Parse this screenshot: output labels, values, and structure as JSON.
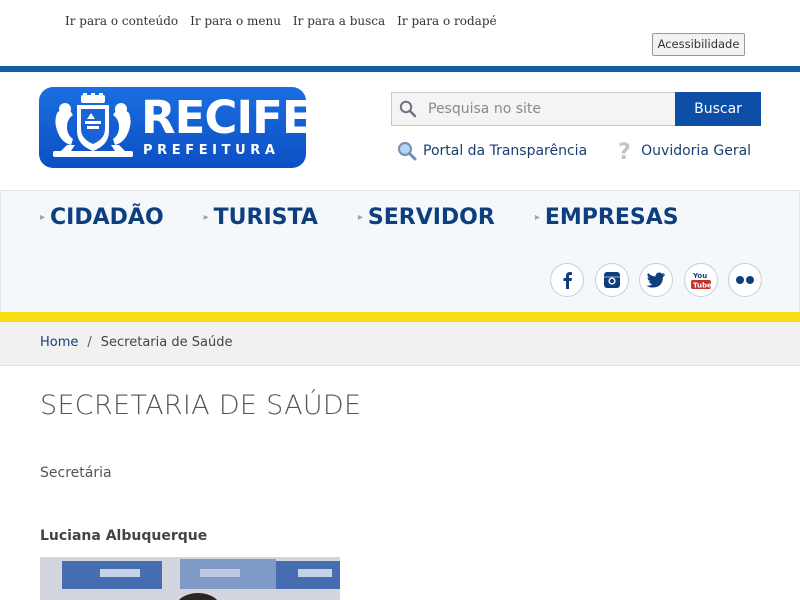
{
  "skip_links": [
    "Ir para o conteúdo",
    "Ir para o menu",
    "Ir para a busca",
    "Ir para o rodapé"
  ],
  "accessibility_label": "Acessibilidade",
  "logo": {
    "word": "RECIFE",
    "sub": "PREFEITURA"
  },
  "search": {
    "placeholder": "Pesquisa no site",
    "button": "Buscar"
  },
  "top_links": [
    "Portal da Transparência",
    "Ouvidoria Geral"
  ],
  "nav": [
    "CIDADÃO",
    "TURISTA",
    "SERVIDOR",
    "EMPRESAS"
  ],
  "social_icons": [
    "facebook-icon",
    "instagram-icon",
    "twitter-icon",
    "youtube-icon",
    "flickr-icon"
  ],
  "breadcrumb": {
    "home": "Home",
    "separator": "/",
    "current": "Secretaria de Saúde"
  },
  "main": {
    "title": "SECRETARIA DE SAÚDE",
    "role_label": "Secretária",
    "person_name": "Luciana Albuquerque"
  },
  "colors": {
    "brand_blue": "#0f5fa8",
    "nav_text": "#0d3f7e",
    "yellow": "#f7dd14",
    "button": "#0d4ea6"
  }
}
